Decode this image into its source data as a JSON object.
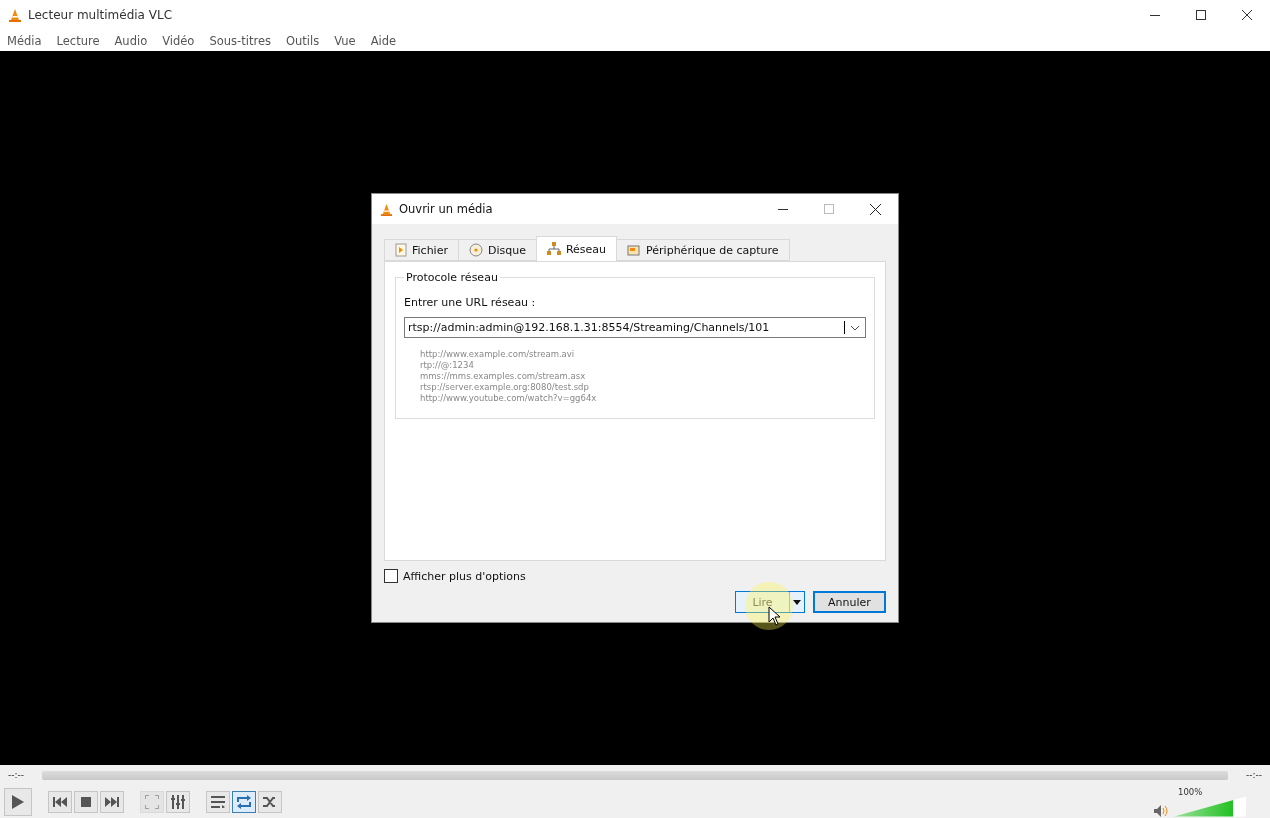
{
  "window": {
    "title": "Lecteur multimédia VLC"
  },
  "menu": [
    "Média",
    "Lecture",
    "Audio",
    "Vidéo",
    "Sous-titres",
    "Outils",
    "Vue",
    "Aide"
  ],
  "dialog": {
    "title": "Ouvrir un média",
    "tabs": [
      {
        "label": "Fichier",
        "selected": false
      },
      {
        "label": "Disque",
        "selected": false
      },
      {
        "label": "Réseau",
        "selected": true
      },
      {
        "label": "Périphérique de capture",
        "selected": false
      }
    ],
    "group_title": "Protocole réseau",
    "url_label": "Entrer une URL réseau :",
    "url_value": "rtsp://admin:admin@192.168.1.31:8554/Streaming/Channels/101",
    "examples": [
      "http://www.example.com/stream.avi",
      "rtp://@:1234",
      "mms://mms.examples.com/stream.asx",
      "rtsp://server.example.org:8080/test.sdp",
      "http://www.youtube.com/watch?v=gg64x"
    ],
    "more_options": {
      "label": "Afficher plus d'options",
      "checked": false
    },
    "play_button": "Lire",
    "cancel_button": "Annuler"
  },
  "controls": {
    "elapsed": "--:--",
    "remaining": "--:--",
    "buttons": [
      {
        "kind": "play",
        "selected": false,
        "disabled": false
      },
      {
        "kind": "prev",
        "selected": false,
        "disabled": false
      },
      {
        "kind": "stop",
        "selected": false,
        "disabled": false
      },
      {
        "kind": "next",
        "selected": false,
        "disabled": false
      },
      {
        "kind": "fullscreen",
        "selected": false,
        "disabled": true
      },
      {
        "kind": "equalizer",
        "selected": false,
        "disabled": false
      },
      {
        "kind": "playlist",
        "selected": false,
        "disabled": false
      },
      {
        "kind": "loop",
        "selected": true,
        "disabled": false
      },
      {
        "kind": "shuffle",
        "selected": false,
        "disabled": false
      }
    ],
    "volume": {
      "reading": "100%",
      "level": 0.82
    }
  }
}
